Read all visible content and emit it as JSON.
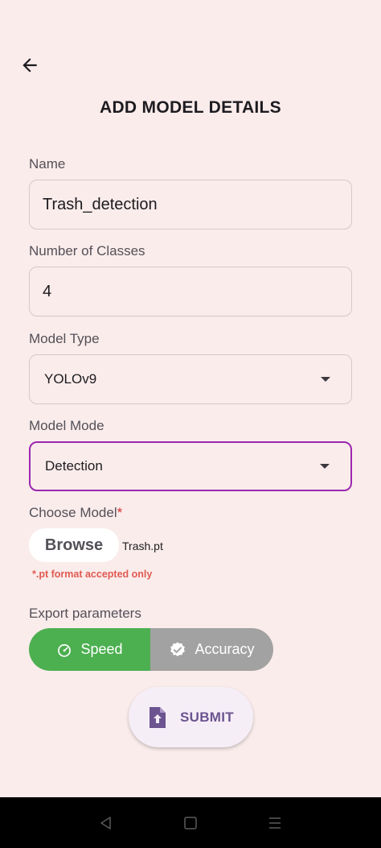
{
  "header": {
    "title": "ADD MODEL DETAILS"
  },
  "form": {
    "name": {
      "label": "Name",
      "value": "Trash_detection"
    },
    "classes": {
      "label": "Number of Classes",
      "value": "4"
    },
    "model_type": {
      "label": "Model Type",
      "value": "YOLOv9"
    },
    "model_mode": {
      "label": "Model Mode",
      "value": "Detection"
    },
    "choose_model": {
      "label": "Choose Model",
      "required_mark": "*",
      "browse_label": "Browse",
      "file_name": "Trash.pt",
      "hint": "*.pt format accepted only"
    },
    "export": {
      "label": "Export parameters",
      "options": [
        {
          "label": "Speed",
          "selected": true,
          "icon": "speedometer-icon"
        },
        {
          "label": "Accuracy",
          "selected": false,
          "icon": "verified-check-icon"
        }
      ]
    },
    "submit_label": "SUBMIT"
  },
  "colors": {
    "background": "#faeceb",
    "accent_focus": "#9c27b0",
    "selected_segment": "#4caf50",
    "unselected_segment": "#a2a2a2",
    "hint": "#e05a52",
    "submit_text": "#6b548f"
  }
}
